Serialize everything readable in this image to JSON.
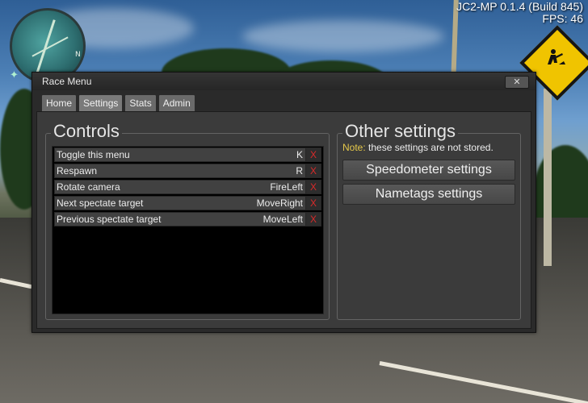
{
  "hud": {
    "version": "JC2-MP 0.1.4 (Build 845)",
    "fps": "FPS: 46",
    "minimap_north": "N"
  },
  "window": {
    "title": "Race Menu",
    "close_label": "✕"
  },
  "tabs": [
    {
      "label": "Home",
      "active": false
    },
    {
      "label": "Settings",
      "active": true
    },
    {
      "label": "Stats",
      "active": false
    },
    {
      "label": "Admin",
      "active": false
    }
  ],
  "controls": {
    "title": "Controls",
    "rows": [
      {
        "action": "Toggle this menu",
        "key": "K",
        "delete": "X"
      },
      {
        "action": "Respawn",
        "key": "R",
        "delete": "X"
      },
      {
        "action": "Rotate camera",
        "key": "FireLeft",
        "delete": "X"
      },
      {
        "action": "Next spectate target",
        "key": "MoveRight",
        "delete": "X"
      },
      {
        "action": "Previous spectate target",
        "key": "MoveLeft",
        "delete": "X"
      }
    ]
  },
  "other": {
    "title": "Other settings",
    "note_prefix": "Note:",
    "note_text": " these settings are not stored.",
    "speedometer_label": "Speedometer settings",
    "nametags_label": "Nametags settings"
  },
  "colors": {
    "note_accent": "#e5c84a",
    "delete_x": "#d92a2a"
  }
}
